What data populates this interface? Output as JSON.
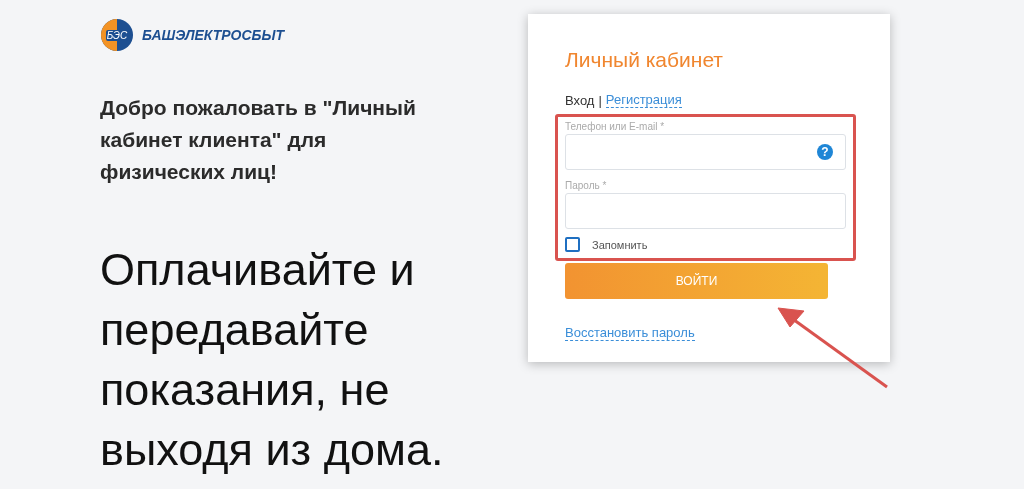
{
  "brand": {
    "logo_text": "БЭС",
    "name": "БАШЭЛЕКТРОСБЫТ"
  },
  "welcome": "Добро пожаловать в \"Личный кабинет клиента\" для физических лиц!",
  "slogan": "Оплачивайте и передавайте показания, не выходя из дома.",
  "login": {
    "title": "Личный кабинет",
    "tabs": [
      {
        "label": "Вход",
        "selected": true
      },
      {
        "label": "Регистрация",
        "selected": false
      }
    ],
    "separator": "|",
    "fields": [
      {
        "label": "Телефон или E-mail *",
        "help": "?"
      },
      {
        "label": "Пароль *"
      }
    ],
    "remember": {
      "label": "Запомнить",
      "checked": false
    },
    "submit": "ВОЙТИ",
    "restore": "Восстановить пароль"
  }
}
